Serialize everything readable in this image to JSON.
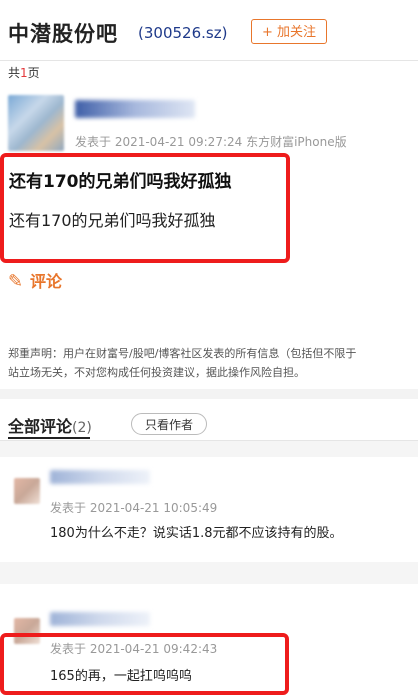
{
  "header": {
    "bar_name": "中潜股份吧",
    "stock_code": "(300526.sz)",
    "follow_label": "+ 加关注"
  },
  "pagination": {
    "prefix": "共",
    "count": "1",
    "suffix": "页"
  },
  "post": {
    "meta": "发表于 2021-04-21 09:27:24 东方财富iPhone版",
    "title": "还有170的兄弟们吗我好孤独",
    "body": "还有170的兄弟们吗我好孤独",
    "comment_label": "评论"
  },
  "disclaimer": {
    "line1": "郑重声明：用户在财富号/股吧/博客社区发表的所有信息（包括但不限于",
    "line2": "站立场无关，不对您构成任何投资建议，据此操作风险自担。"
  },
  "comments_section": {
    "tab_label": "全部评论",
    "tab_count": "(2)",
    "only_author_label": "只看作者",
    "comments": [
      {
        "meta": "发表于 2021-04-21 10:05:49",
        "text": "180为什么不走？说实话1.8元都不应该持有的股。"
      },
      {
        "meta": "发表于 2021-04-21 09:42:43",
        "text": "165的再，一起扛呜呜呜"
      }
    ]
  },
  "colors": {
    "accent": "#e8762c",
    "highlight": "#ee1c1c",
    "code": "#1f3a8a"
  }
}
